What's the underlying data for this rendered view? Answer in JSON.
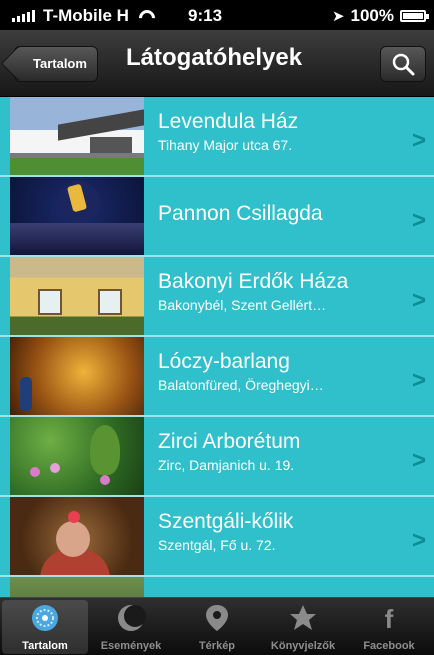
{
  "status_bar": {
    "carrier": "T-Mobile H",
    "time": "9:13",
    "battery": "100%"
  },
  "nav": {
    "back_label": "Tartalom",
    "title": "Látogatóhelyek"
  },
  "list": [
    {
      "title": "Levendula Ház",
      "subtitle": "Tihany Major utca 67."
    },
    {
      "title": "Pannon Csillagda",
      "subtitle": ""
    },
    {
      "title": "Bakonyi Erdők Háza",
      "subtitle": "Bakonybél, Szent Gellért…"
    },
    {
      "title": "Lóczy-barlang",
      "subtitle": "Balatonfüred, Öreghegyi…"
    },
    {
      "title": "Zirci Arborétum",
      "subtitle": "Zirc, Damjanich u. 19."
    },
    {
      "title": "Szentgáli-kőlik",
      "subtitle": "Szentgál, Fő u. 72."
    }
  ],
  "tabbar": [
    {
      "label": "Tartalom",
      "icon": "contents-icon"
    },
    {
      "label": "Események",
      "icon": "events-icon"
    },
    {
      "label": "Térkép",
      "icon": "map-pin-icon"
    },
    {
      "label": "Könyvjelzők",
      "icon": "bookmark-star-icon"
    },
    {
      "label": "Facebook",
      "icon": "facebook-icon"
    }
  ],
  "colors": {
    "list_bg": "#2fc0cc",
    "chevron": "#0e8b96",
    "navbar": "#222222"
  }
}
